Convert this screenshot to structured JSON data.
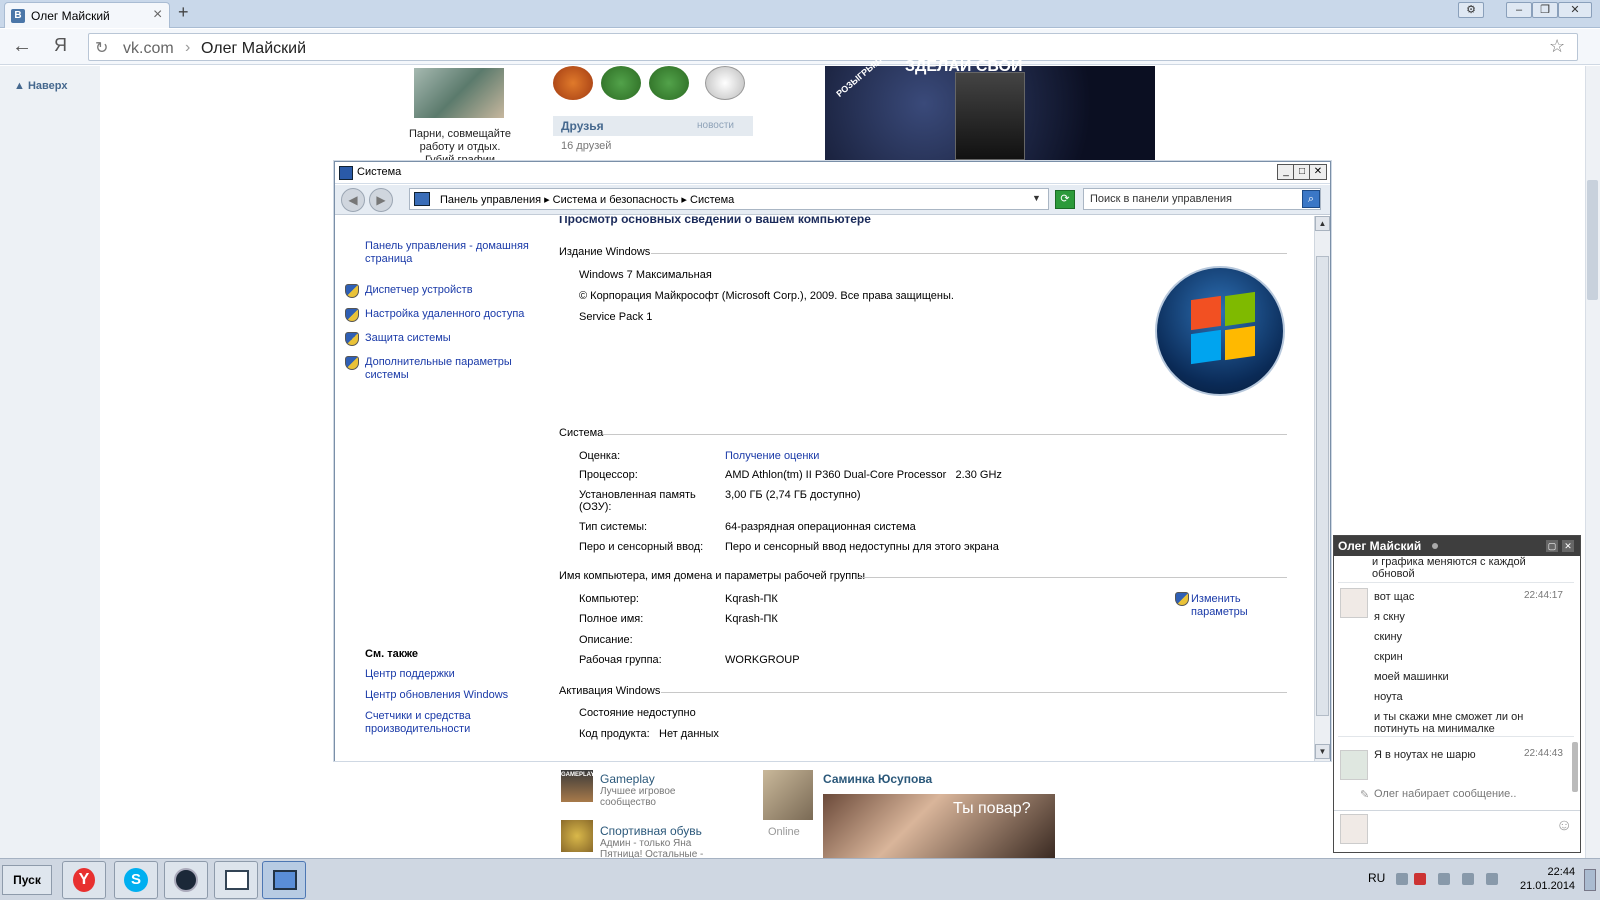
{
  "browser": {
    "tab_title": "Олег Майский",
    "tab_favicon": "В",
    "new_tab": "+",
    "url_host": "vk.com",
    "url_sep": "›",
    "url_title": "Олег Майский",
    "back_icon": "←",
    "ya_icon": "Я",
    "reload_icon": "↻",
    "star_icon": "☆",
    "win_buttons": [
      "⚙",
      "–",
      "❐",
      "✕"
    ]
  },
  "vk": {
    "naverh": "▲ Наверх",
    "avatar_text": "Парни, совмещайте работу и отдых. Губий графии",
    "friends": {
      "title": "Друзья",
      "news": "новости",
      "count": "16 друзей"
    },
    "ad_text": "ЗДЕЛАЙ СВОЙ",
    "ad_badge": "РОЗЫГРЫШ",
    "groups": [
      {
        "name": "Gameplay",
        "desc": "Лучшее игровое сообщество",
        "icon_text": "GAMEPLAY"
      },
      {
        "name": "Спортивная обувь",
        "desc": "Админ - только Яна Пятница! Остальные -"
      }
    ],
    "friend_post": {
      "name": "Саминка Юсупова",
      "status": "Online",
      "caption": "Ты повар?"
    }
  },
  "system_window": {
    "title": "Система",
    "buttons": [
      "_",
      "□",
      "✕"
    ],
    "breadcrumb": "Панель управления  ▸  Система и безопасность  ▸  Система",
    "search_placeholder": "Поиск в панели управления",
    "heading_partial": "Просмотр основных сведений о вашем компьютере",
    "left_links": [
      "Панель управления - домашняя страница",
      "Диспетчер устройств",
      "Настройка удаленного доступа",
      "Защита системы",
      "Дополнительные параметры системы"
    ],
    "see_also": {
      "title": "См. также",
      "links": [
        "Центр поддержки",
        "Центр обновления Windows",
        "Счетчики и средства производительности"
      ]
    },
    "edition": {
      "header": "Издание Windows",
      "name": "Windows 7 Максимальная",
      "copyright": "© Корпорация Майкрософт (Microsoft Corp.), 2009. Все права защищены.",
      "sp": "Service Pack 1"
    },
    "system": {
      "header": "Система",
      "rows": [
        {
          "label": "Оценка:",
          "value": "Получение оценки",
          "link": true
        },
        {
          "label": "Процессор:",
          "value": "AMD Athlon(tm) II P360 Dual-Core Processor   2.30 GHz"
        },
        {
          "label": "Установленная память (ОЗУ):",
          "value": "3,00 ГБ (2,74 ГБ доступно)"
        },
        {
          "label": "Тип системы:",
          "value": "64-разрядная операционная система"
        },
        {
          "label": "Перо и сенсорный ввод:",
          "value": "Перо и сенсорный ввод недоступны для этого экрана"
        }
      ]
    },
    "computer": {
      "header": "Имя компьютера, имя домена и параметры рабочей группы",
      "change_link": "Изменить параметры",
      "rows": [
        {
          "label": "Компьютер:",
          "value": "Kqrash-ПК"
        },
        {
          "label": "Полное имя:",
          "value": "Kqrash-ПК"
        },
        {
          "label": "Описание:",
          "value": ""
        },
        {
          "label": "Рабочая группа:",
          "value": "WORKGROUP"
        }
      ]
    },
    "activation": {
      "header": "Активация Windows",
      "status": "Состояние недоступно",
      "product_label": "Код продукта:",
      "product_value": "Нет данных"
    }
  },
  "chat": {
    "name": "Олег Майский",
    "top_partial": "и графика меняются с каждой обновой",
    "messages_1": [
      "вот щас",
      "я скну",
      "скину",
      "скрин",
      "моей машинки",
      "ноута",
      "и ты скажи мне сможет ли он потинуть на минималке"
    ],
    "time_1": "22:44:17",
    "message_2": "Я в ноутах не шарю",
    "time_2": "22:44:43",
    "typing": "Олег набирает сообщение..",
    "smile_icon": "☺"
  },
  "taskbar": {
    "start": "Пуск",
    "lang": "RU",
    "time": "22:44",
    "date": "21.01.2014"
  }
}
